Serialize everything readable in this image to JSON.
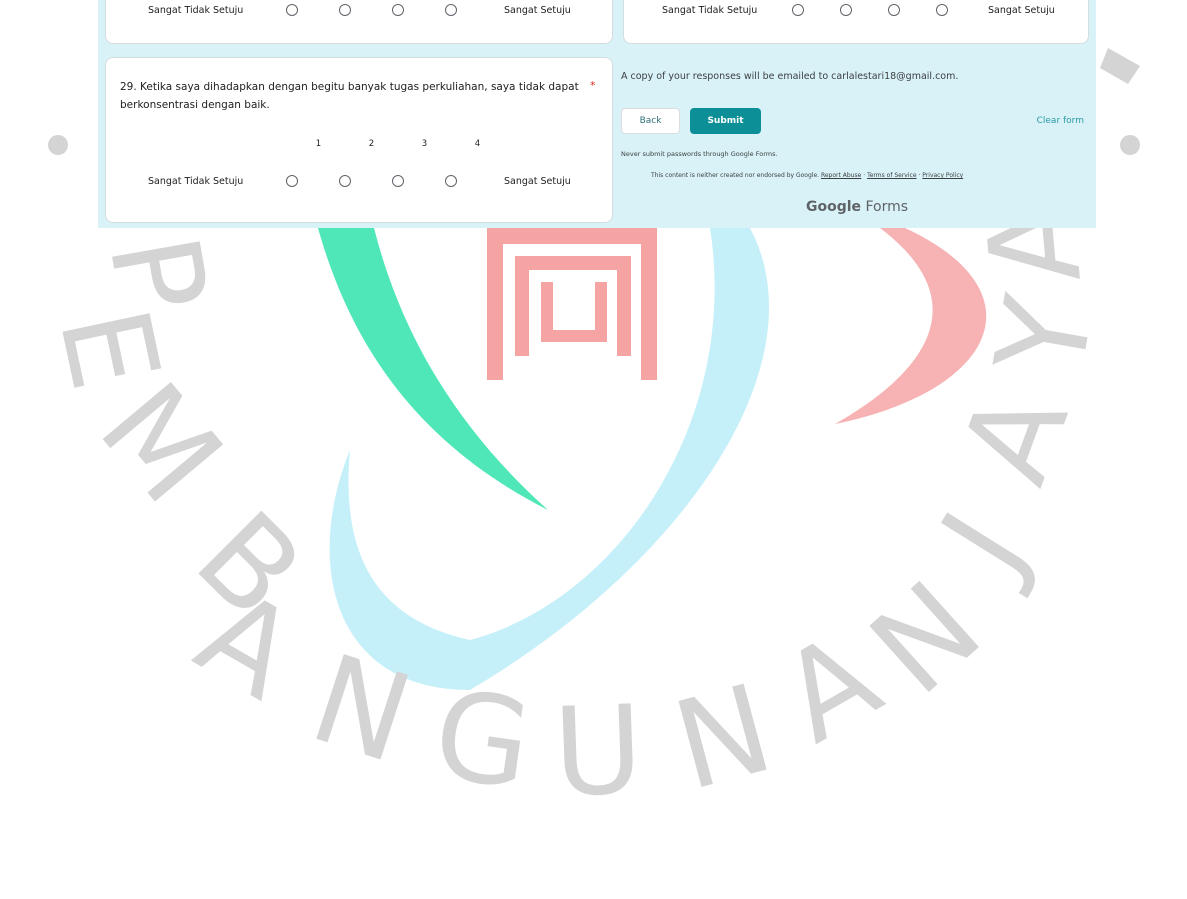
{
  "colors": {
    "strip_background": "#d9f2f7",
    "accent": "#0d8f98",
    "required": "#d93025",
    "watermark": "#d4d4d4",
    "logo_green": "#4fe7b8",
    "logo_cyan": "#bfeef8",
    "logo_red": "#f7b3b3"
  },
  "watermark": {
    "letters": [
      "Y",
      "P",
      "E",
      "M",
      "B",
      "A",
      "N",
      "G",
      "U",
      "N",
      "A",
      "N",
      "J",
      "A",
      "Y",
      "A"
    ]
  },
  "prev_left": {
    "left_label": "Sangat Tidak Setuju",
    "right_label": "Sangat Setuju"
  },
  "prev_right": {
    "left_label": "Sangat Tidak Setuju",
    "right_label": "Sangat Setuju"
  },
  "question": {
    "title": "29. Ketika saya dihadapkan dengan begitu banyak tugas perkuliahan, saya tidak dapat berkonsentrasi dengan baik.",
    "required_marker": "*",
    "scale": [
      "1",
      "2",
      "3",
      "4"
    ],
    "left_label": "Sangat Tidak Setuju",
    "right_label": "Sangat Setuju"
  },
  "footer": {
    "copy_note": "A copy of your responses will be emailed to carlalestari18@gmail.com.",
    "back_label": "Back",
    "submit_label": "Submit",
    "clear_label": "Clear form",
    "never_note": "Never submit passwords through Google Forms.",
    "disclaimer_text": "This content is neither created nor endorsed by Google.",
    "report_abuse": "Report Abuse",
    "terms": "Terms of Service",
    "privacy": "Privacy Policy",
    "sep": "·",
    "logo_google": "Google",
    "logo_forms": "Forms"
  }
}
